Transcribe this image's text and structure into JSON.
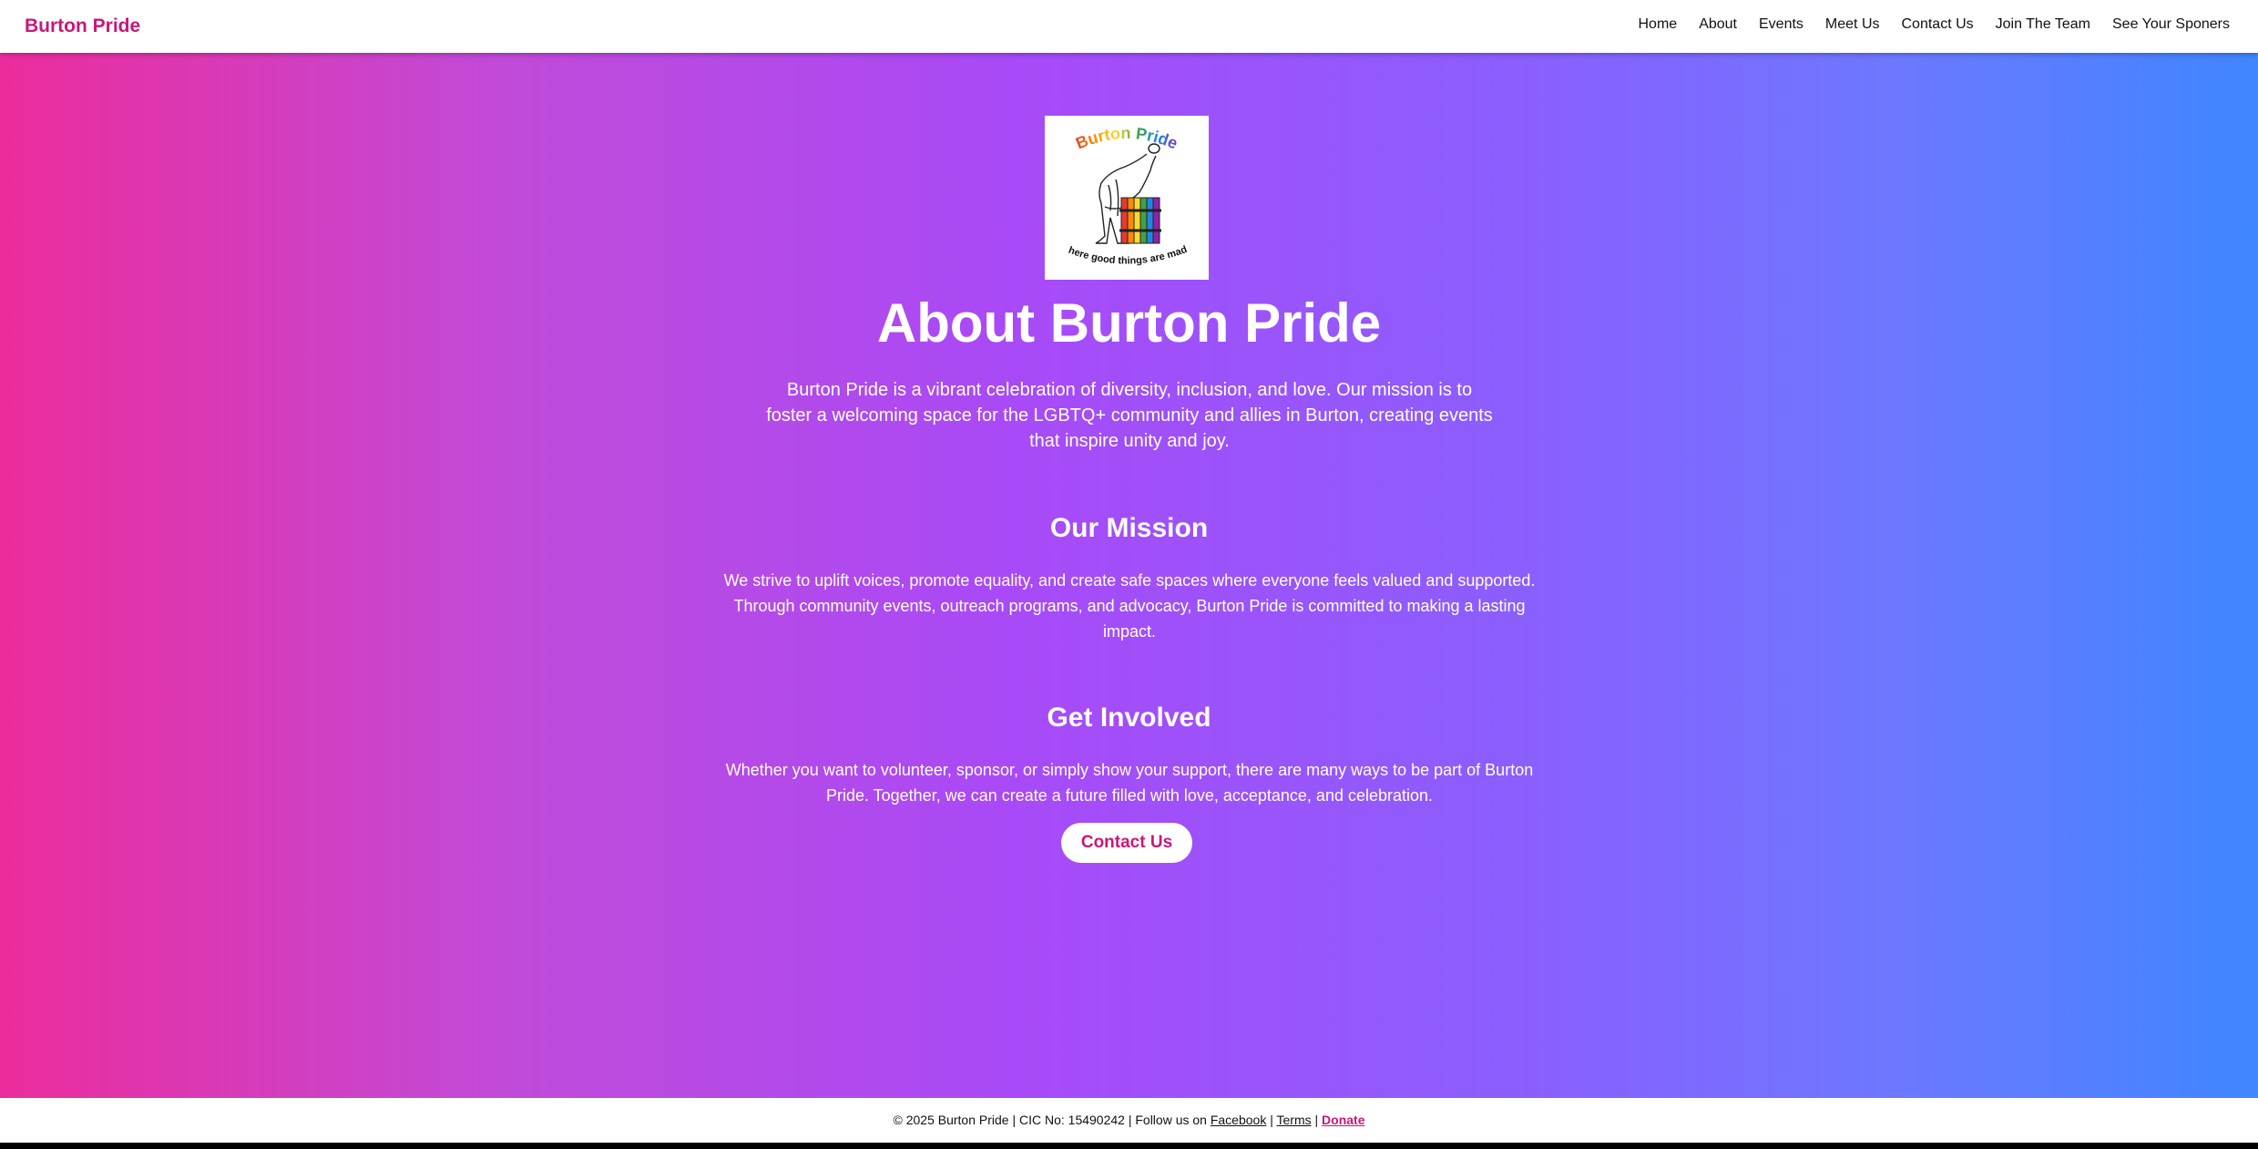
{
  "header": {
    "brand": "Burton Pride",
    "nav": [
      {
        "label": "Home"
      },
      {
        "label": "About"
      },
      {
        "label": "Events"
      },
      {
        "label": "Meet Us"
      },
      {
        "label": "Contact Us"
      },
      {
        "label": "Join The Team"
      },
      {
        "label": "See Your Sponers"
      }
    ]
  },
  "logo": {
    "top_text": "Burton Pride",
    "tagline": "where good things are made",
    "icon": "burton-pride-barrel-logo"
  },
  "main": {
    "title": "About Burton Pride",
    "intro": "Burton Pride is a vibrant celebration of diversity, inclusion, and love. Our mission is to foster a welcoming space for the LGBTQ+ community and allies in Burton, creating events that inspire unity and joy.",
    "mission_heading": "Our Mission",
    "mission_text": "We strive to uplift voices, promote equality, and create safe spaces where everyone feels valued and supported. Through community events, outreach programs, and advocacy, Burton Pride is committed to making a lasting impact.",
    "involved_heading": "Get Involved",
    "involved_text": "Whether you want to volunteer, sponsor, or simply show your support, there are many ways to be part of Burton Pride. Together, we can create a future filled with love, acceptance, and celebration.",
    "cta_label": "Contact Us"
  },
  "footer": {
    "text": "© 2025 Burton Pride | CIC No: 15490242 | Follow us on",
    "facebook": "Facebook",
    "sep1": "|",
    "terms": "Terms",
    "sep2": "|",
    "donate": "Donate"
  },
  "colors": {
    "brand": "#c8177a",
    "gradient_start": "#ec2c9c",
    "gradient_mid": "#a84af7",
    "gradient_end": "#3f86ff"
  }
}
